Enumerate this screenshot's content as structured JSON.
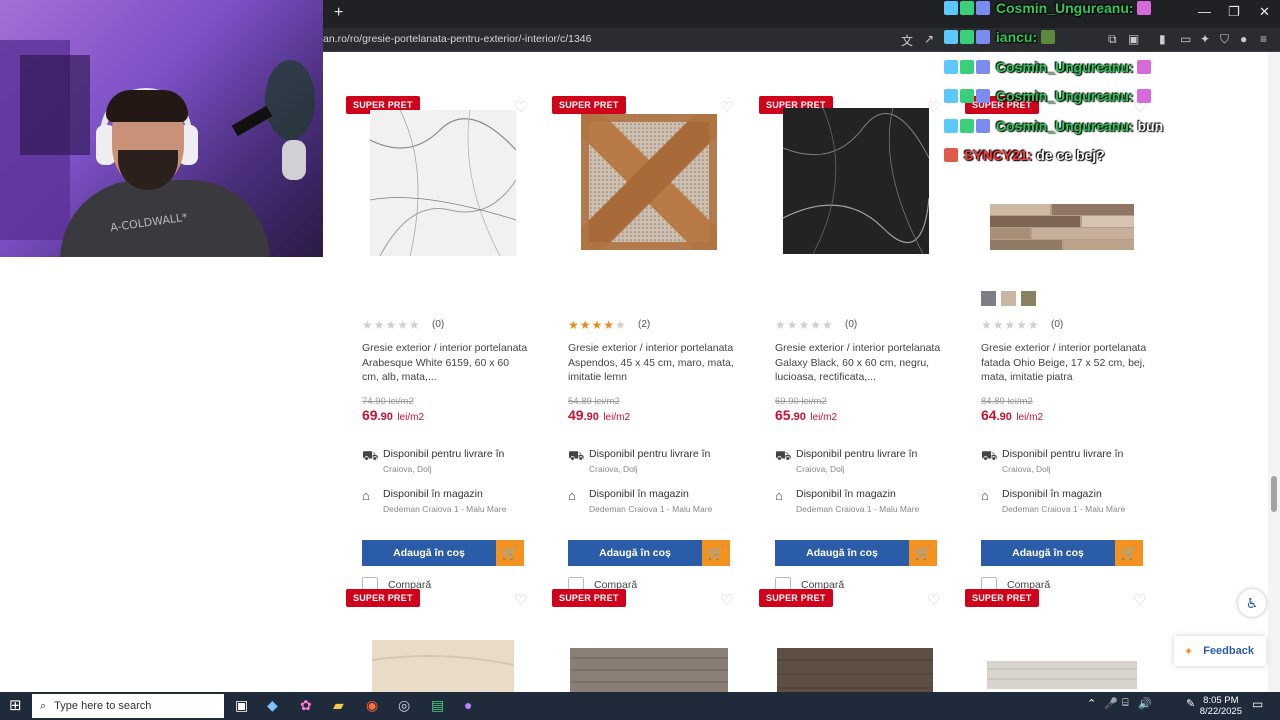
{
  "browser": {
    "url": "an.ro/ro/gresie-portelanata-pentru-exterior/-interior/c/1346",
    "new_tab": "+"
  },
  "products_row1": [
    {
      "badge": "SUPER PRET",
      "rating": 0,
      "reviews": "(0)",
      "name": "Gresie exterior / interior portelanata Arabesque White 6159, 60 x 60 cm, alb, mata,...",
      "old_price": "74.90 lei/m2",
      "price_int": "69",
      "price_dec": ".90",
      "unit": "lei/m2",
      "delivery": "Disponibil pentru livrare în",
      "delivery_loc": "Craiova, Dolj",
      "store": "Disponibil în magazin",
      "store_loc": "Dedeman Craiova 1 - Malu Mare",
      "add_label": "Adaugă în coș",
      "compare_label": "Compară"
    },
    {
      "badge": "SUPER PRET",
      "rating": 4.5,
      "reviews": "(2)",
      "name": "Gresie exterior / interior portelanata Aspendos, 45 x 45 cm, maro, mata, imitatie lemn",
      "old_price": "54.89 lei/m2",
      "price_int": "49",
      "price_dec": ".90",
      "unit": "lei/m2",
      "delivery": "Disponibil pentru livrare în",
      "delivery_loc": "Craiova, Dolj",
      "store": "Disponibil în magazin",
      "store_loc": "Dedeman Craiova 1 - Malu Mare",
      "add_label": "Adaugă în coș",
      "compare_label": "Compară"
    },
    {
      "badge": "SUPER PRET",
      "rating": 0,
      "reviews": "(0)",
      "name": "Gresie exterior / interior portelanata Galaxy Black, 60 x 60 cm, negru, lucioasa, rectificata,...",
      "old_price": "69.90 lei/m2",
      "price_int": "65",
      "price_dec": ".90",
      "unit": "lei/m2",
      "delivery": "Disponibil pentru livrare în",
      "delivery_loc": "Craiova, Dolj",
      "store": "Disponibil în magazin",
      "store_loc": "Dedeman Craiova 1 - Malu Mare",
      "add_label": "Adaugă în coș",
      "compare_label": "Compară"
    },
    {
      "badge": "SUPER PRET",
      "rating": 0,
      "reviews": "(0)",
      "name": "Gresie exterior / interior portelanata fatada Ohio Beige, 17 x 52 cm, bej, mata, imitatie piatra",
      "old_price": "84.89 lei/m2",
      "price_int": "64",
      "price_dec": ".90",
      "unit": "lei/m2",
      "delivery": "Disponibil pentru livrare în",
      "delivery_loc": "Craiova, Dolj",
      "store": "Disponibil în magazin",
      "store_loc": "Dedeman Craiova 1 - Malu Mare",
      "add_label": "Adaugă în coș",
      "compare_label": "Compară"
    }
  ],
  "products_row2": [
    {
      "badge": "SUPER PRET"
    },
    {
      "badge": "SUPER PRET"
    },
    {
      "badge": "SUPER PRET"
    },
    {
      "badge": "SUPER PRET"
    }
  ],
  "chat": [
    {
      "user": "Cosmin_Ungureanu:",
      "text": ""
    },
    {
      "user": "iancu:",
      "text": ""
    },
    {
      "user": "Cosmin_Ungureanu:",
      "text": ""
    },
    {
      "user": "Cosmin_Ungureanu:",
      "text": ""
    },
    {
      "user": "Cosmin_Ungureanu:",
      "text": "bun"
    },
    {
      "user": "SYNCY21:",
      "text": "de ce bej?"
    }
  ],
  "stream": {
    "shirt_text": "A-COLDWALL*"
  },
  "widgets": {
    "feedback": "Feedback"
  },
  "taskbar": {
    "search_placeholder": "Type here to search",
    "time": "8:05 PM",
    "date": "8/22/2025"
  },
  "colors": {
    "badge_red": "#d0021b",
    "price_red": "#c4122f",
    "button_blue": "#2b5ca8",
    "cart_orange": "#f39221",
    "star_orange": "#e98a19"
  }
}
